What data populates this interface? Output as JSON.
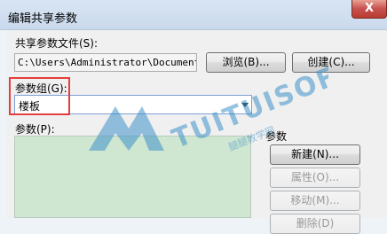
{
  "window": {
    "title": "编辑共享参数",
    "close_glyph": "X"
  },
  "file_section": {
    "label": "共享参数文件(S):",
    "path_value": "C:\\Users\\Administrator\\Documents\\(",
    "browse_label": "浏览(B)...",
    "create_label": "创建(C)..."
  },
  "group_section": {
    "label": "参数组(G):",
    "selected_value": "楼板"
  },
  "parameters_list": {
    "label": "参数(P):"
  },
  "parameter_actions": {
    "label": "参数",
    "buttons": [
      {
        "label": "新建(N)...",
        "enabled": true
      },
      {
        "label": "属性(O)...",
        "enabled": false
      },
      {
        "label": "移动(M)...",
        "enabled": false
      },
      {
        "label": "删除(D)",
        "enabled": false
      }
    ]
  },
  "watermark": {
    "text": "TUITUISOFT",
    "sub_text": "腿腿教学网"
  },
  "colors": {
    "highlight": "#e53d3d",
    "list_background": "#cfe6d1",
    "watermark": "#3f93c9"
  }
}
